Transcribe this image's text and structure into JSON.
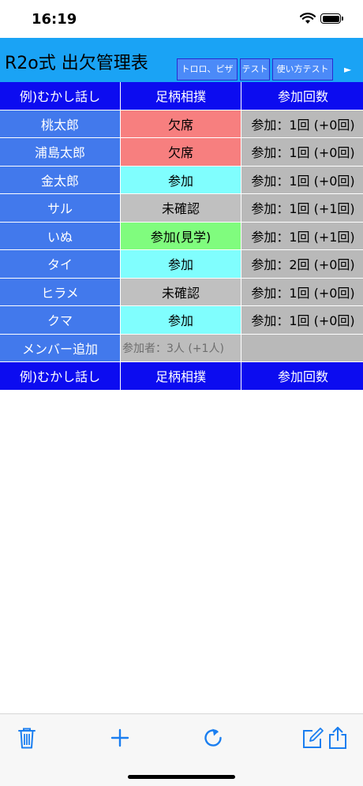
{
  "status_bar": {
    "time": "16:19"
  },
  "header": {
    "title": "R2o式 出欠管理表",
    "tabs": [
      "トロロ、ピザ",
      "テスト",
      "使い方テスト"
    ],
    "more_arrow": "►"
  },
  "table": {
    "header": [
      "例)むかし話し",
      "足柄相撲",
      "参加回数"
    ],
    "rows": [
      {
        "name": "桃太郎",
        "status": "欠席",
        "count": "参加：1回 (+0回)"
      },
      {
        "name": "浦島太郎",
        "status": "欠席",
        "count": "参加：1回 (+0回)"
      },
      {
        "name": "金太郎",
        "status": "参加",
        "count": "参加：1回 (+0回)"
      },
      {
        "name": "サル",
        "status": "未確認",
        "count": "参加：1回 (+1回)"
      },
      {
        "name": "いぬ",
        "status": "参加(見学)",
        "count": "参加：1回 (+1回)"
      },
      {
        "name": "タイ",
        "status": "参加",
        "count": "参加：2回 (+0回)"
      },
      {
        "name": "ヒラメ",
        "status": "未確認",
        "count": "参加：1回 (+0回)"
      },
      {
        "name": "クマ",
        "status": "参加",
        "count": "参加：1回 (+0回)"
      }
    ],
    "add_member": "メンバー追加",
    "participants_summary": "参加者：3人 (+1人)",
    "footer": [
      "例)むかし話し",
      "足柄相撲",
      "参加回数"
    ]
  },
  "colors": {
    "header_bg": "#1aa3f5",
    "column_header": "#0c0cf0",
    "name_cell": "#4279ec",
    "absent": "#f77f7f",
    "attend": "#80fefe",
    "unconfirmed": "#c0c0c0",
    "observe": "#80fc7e",
    "toolbar_icon": "#1a7ef0"
  },
  "toolbar": {
    "icons": [
      "trash-icon",
      "plus-icon",
      "refresh-icon",
      "compose-icon",
      "share-icon"
    ]
  }
}
